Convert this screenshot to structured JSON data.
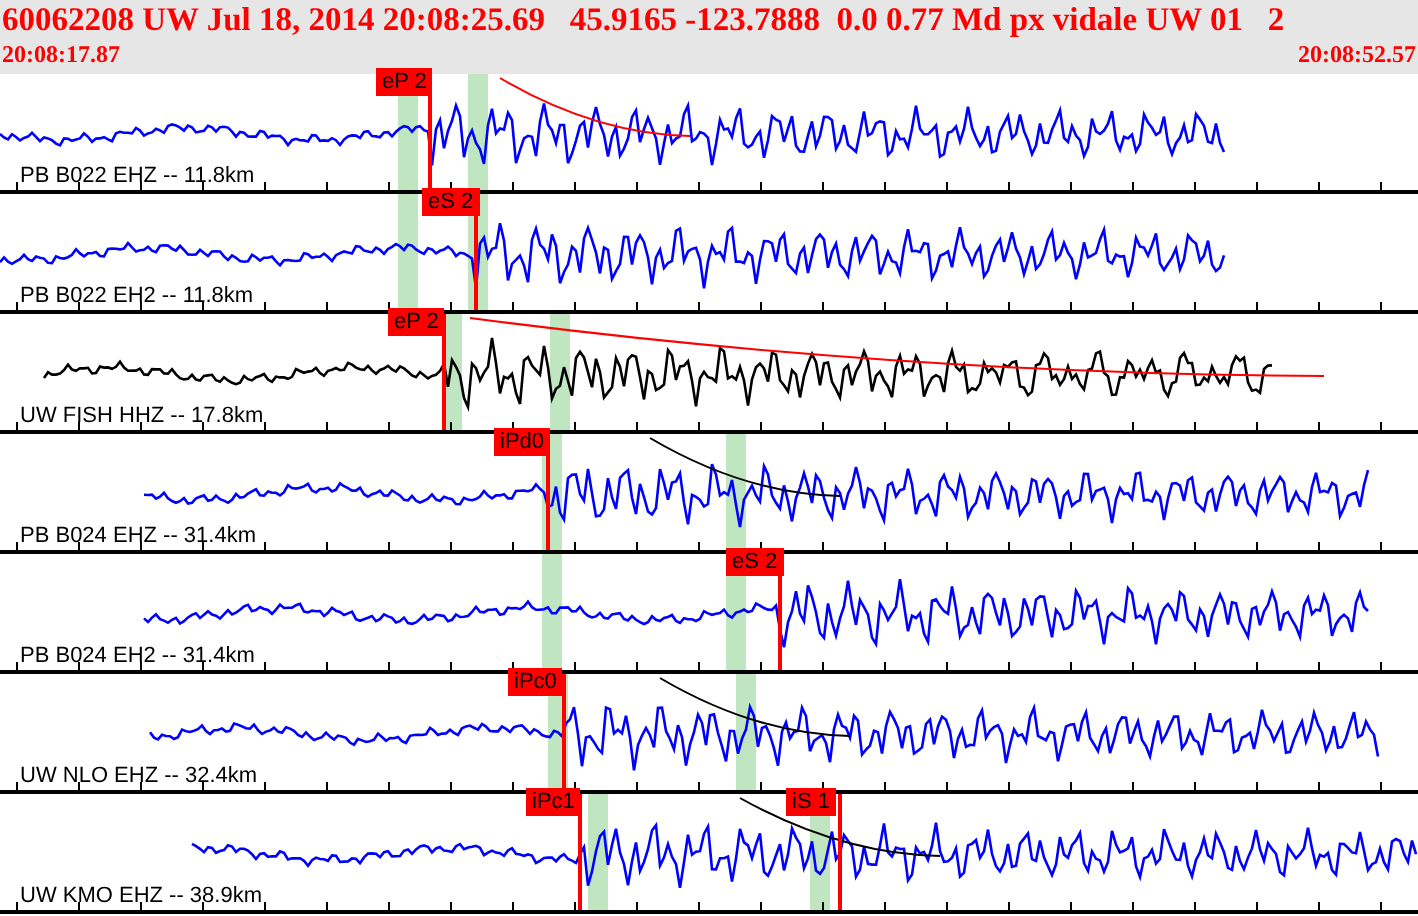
{
  "header": {
    "title": "60062208 UW Jul 18, 2014 20:08:25.69   45.9165 -123.7888  0.0 0.77 Md px vidale UW 01   2",
    "start_time": "20:08:17.87",
    "end_time": "20:08:52.57"
  },
  "traces": [
    {
      "label": "PB B022 EHZ -- 11.8km",
      "color": "#0000ff",
      "picks": [
        {
          "label": "eP 2"
        }
      ]
    },
    {
      "label": "PB B022 EH2 -- 11.8km",
      "color": "#0000ff",
      "picks": [
        {
          "label": "eS 2"
        }
      ]
    },
    {
      "label": "UW FISH HHZ -- 17.8km",
      "color": "#000000",
      "picks": [
        {
          "label": "eP 2"
        }
      ]
    },
    {
      "label": "PB B024 EHZ -- 31.4km",
      "color": "#0000ff",
      "picks": [
        {
          "label": "iPd0"
        }
      ]
    },
    {
      "label": "PB B024 EH2 -- 31.4km",
      "color": "#0000ff",
      "picks": [
        {
          "label": "eS 2"
        }
      ]
    },
    {
      "label": "UW NLO EHZ -- 32.4km",
      "color": "#0000ff",
      "picks": [
        {
          "label": "iPc0"
        }
      ]
    },
    {
      "label": "UW KMO EHZ -- 38.9km",
      "color": "#0000ff",
      "picks": [
        {
          "label": "iPc1"
        },
        {
          "label": "iS 1"
        }
      ]
    }
  ]
}
